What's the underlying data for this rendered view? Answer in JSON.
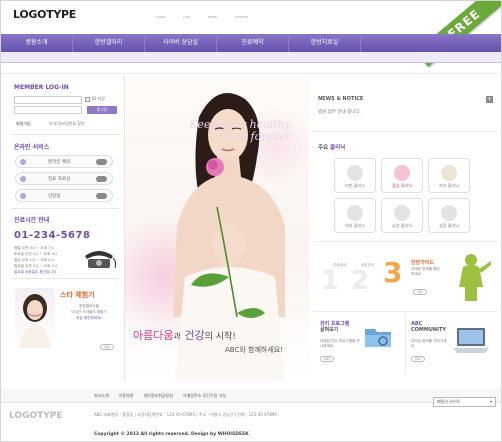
{
  "header": {
    "logo_text": "LOGOTYPE",
    "top_links": [
      "LOGIN",
      "JOIN",
      "HOME",
      "SITEMAP"
    ],
    "free_badge": "FREE"
  },
  "nav": {
    "items": [
      "병원소개",
      "한방갤러리",
      "사이버 상담실",
      "진료예약",
      "한방치료실"
    ]
  },
  "login": {
    "title_member": "MEMBER",
    "title_login": "LOG-IN",
    "save_id_label": "ID 저장",
    "login_button": "로그인",
    "join_link": "회원가입",
    "find_link": "아이디/비밀번호 찾기"
  },
  "online_service": {
    "title_1": "온라인",
    "title_2": "서비스",
    "items": [
      "온라인 예약",
      "진료 자료실",
      "상담실"
    ]
  },
  "hours": {
    "title_1": "진료시간",
    "title_2": "안내",
    "phone": "01-234-5678",
    "lines": [
      "평일 오전 9시 ~ 오후 7시",
      "토요일 오전 9시 ~ 오후 3시",
      "점심 오후 1시 ~ 오후 2시",
      "일요일 오전 9시 ~ 오후 1시",
      "일요일 공휴일은 휴진입니다"
    ]
  },
  "mypage": {
    "title": "스타 체험기",
    "text_1": "한방클리닉을",
    "text_2": "다녀간 스타들의 체험기",
    "text_3": "지금 확인하세요!",
    "go": "GO"
  },
  "hero": {
    "watermark": "Keep your healthy life forever",
    "slogan_1": "아름다움",
    "slogan_2": "과",
    "slogan_3": "건강",
    "slogan_4": "의 시작!",
    "slogan_sub": "ABC와 함께하세요!"
  },
  "news": {
    "title": "NEWS & NOTICE",
    "item": "병원 업무 안내 합니다.",
    "more_icon": "plus-icon"
  },
  "clinics": {
    "title_1": "주요",
    "title_2": "클리닉",
    "items": [
      "비만 클리닉",
      "불임 클리닉",
      "피부 클리닉",
      "여성 클리닉",
      "남성 클리닉",
      "성장 클리닉"
    ]
  },
  "guide": {
    "step1": "1",
    "step1_label": "진료안내",
    "step2": "2",
    "step2_label": "상담안내",
    "step3": "3",
    "step3_title": "한방가이드",
    "step3_text": "자세한 정보를 확인하세요",
    "go": "GO"
  },
  "care": {
    "title_1": "관리 프로그램",
    "title_2": "살펴보기",
    "text": "다양한 관리 프로그램을 만나보세요",
    "go": "GO"
  },
  "community": {
    "title_1": "ABC",
    "title_2": "COMMUNITY",
    "text": "유익한 정보를 가져가세요",
    "go": "GO"
  },
  "footer": {
    "links": [
      "회사소개",
      "이용약관",
      "개인정보취급방침",
      "이메일주소 무단수집 거부"
    ],
    "logo": "LOGOTYPE",
    "family_site": "패밀리 사이트",
    "address": "ABC 대표원장 : 홍길동 | 사업자등록번호 : 123-45-67890 | 주소 : 서울시 강남구 | 전화 : 123-45-67890",
    "copyright": "Copyright © 2013 All rights reserved.  Design by WHOISDESK"
  }
}
